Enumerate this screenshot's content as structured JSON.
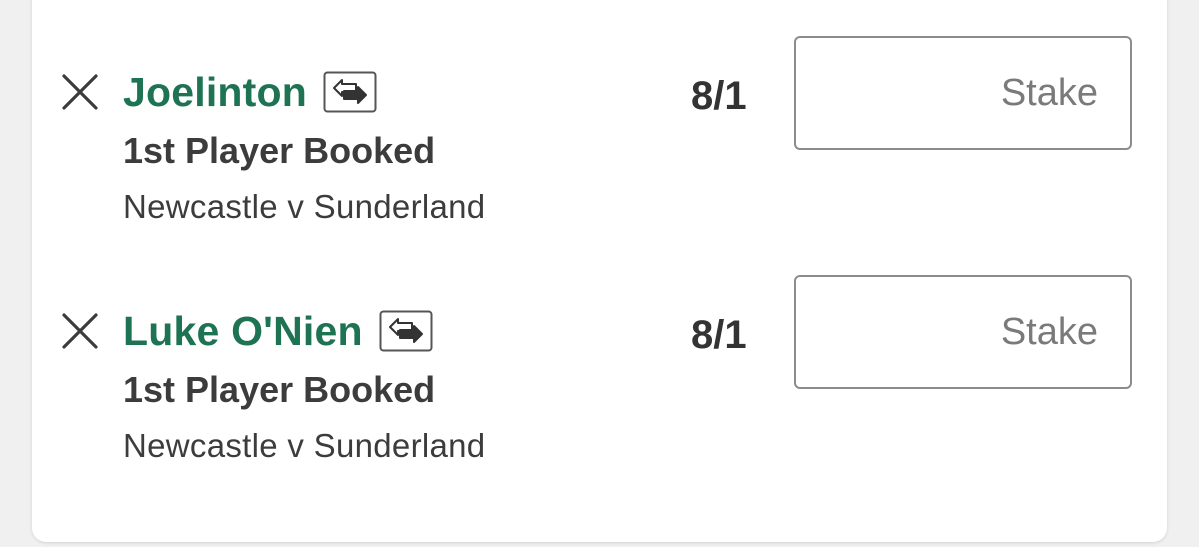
{
  "selections": [
    {
      "runner": "Joelinton",
      "market": "1st Player Booked",
      "event": "Newcastle v Sunderland",
      "odds": "8/1",
      "stake_value": "",
      "stake_placeholder": "Stake",
      "remove_icon": "close-icon",
      "swap_icon": "cash-out-swap-icon"
    },
    {
      "runner": "Luke O'Nien",
      "market": "1st Player Booked",
      "event": "Newcastle v Sunderland",
      "odds": "8/1",
      "stake_value": "",
      "stake_placeholder": "Stake",
      "remove_icon": "close-icon",
      "swap_icon": "cash-out-swap-icon"
    }
  ],
  "colors": {
    "runner_name": "#1d7352",
    "text_dark": "#3c3c3c",
    "stake_border": "#8c8c8c",
    "background": "#f0f0f0",
    "card": "#ffffff"
  }
}
